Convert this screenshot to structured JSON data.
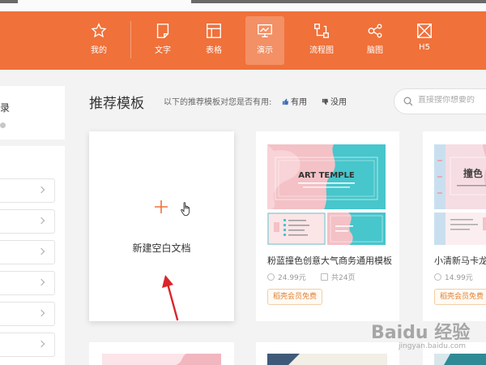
{
  "colors": {
    "accent": "#f0713a",
    "badge": "#e0843a",
    "arrow": "#d9262b"
  },
  "nav": {
    "items": [
      {
        "label": "我的",
        "icon": "star-icon"
      },
      {
        "label": "文字",
        "icon": "document-icon"
      },
      {
        "label": "表格",
        "icon": "table-icon"
      },
      {
        "label": "演示",
        "icon": "presentation-icon",
        "active": true
      },
      {
        "label": "流程图",
        "icon": "flowchart-icon"
      },
      {
        "label": "脑图",
        "icon": "mindmap-icon"
      },
      {
        "label": "H5",
        "icon": "h5-icon"
      }
    ]
  },
  "sidebar": {
    "header_label": "录"
  },
  "main": {
    "title": "推荐模板",
    "feedback_prompt": "以下的推荐模板对您是否有用:",
    "useful_label": "有用",
    "useless_label": "没用"
  },
  "search": {
    "placeholder": "直接搜你想要的"
  },
  "blank_card": {
    "label": "新建空白文档"
  },
  "templates": [
    {
      "name": "粉蓝撞色创意大气商务通用模板",
      "thumb_title": "ART TEMPLE",
      "price": "24.99元",
      "pages": "共24页",
      "badge": "稻壳会员免费"
    },
    {
      "name": "小清新马卡龙",
      "thumb_title": "撞色",
      "price": "14.99元",
      "badge": "稻壳会员免费"
    }
  ],
  "watermark": {
    "text": "Baidu 经验",
    "sub": "jingyan.baidu.com"
  }
}
